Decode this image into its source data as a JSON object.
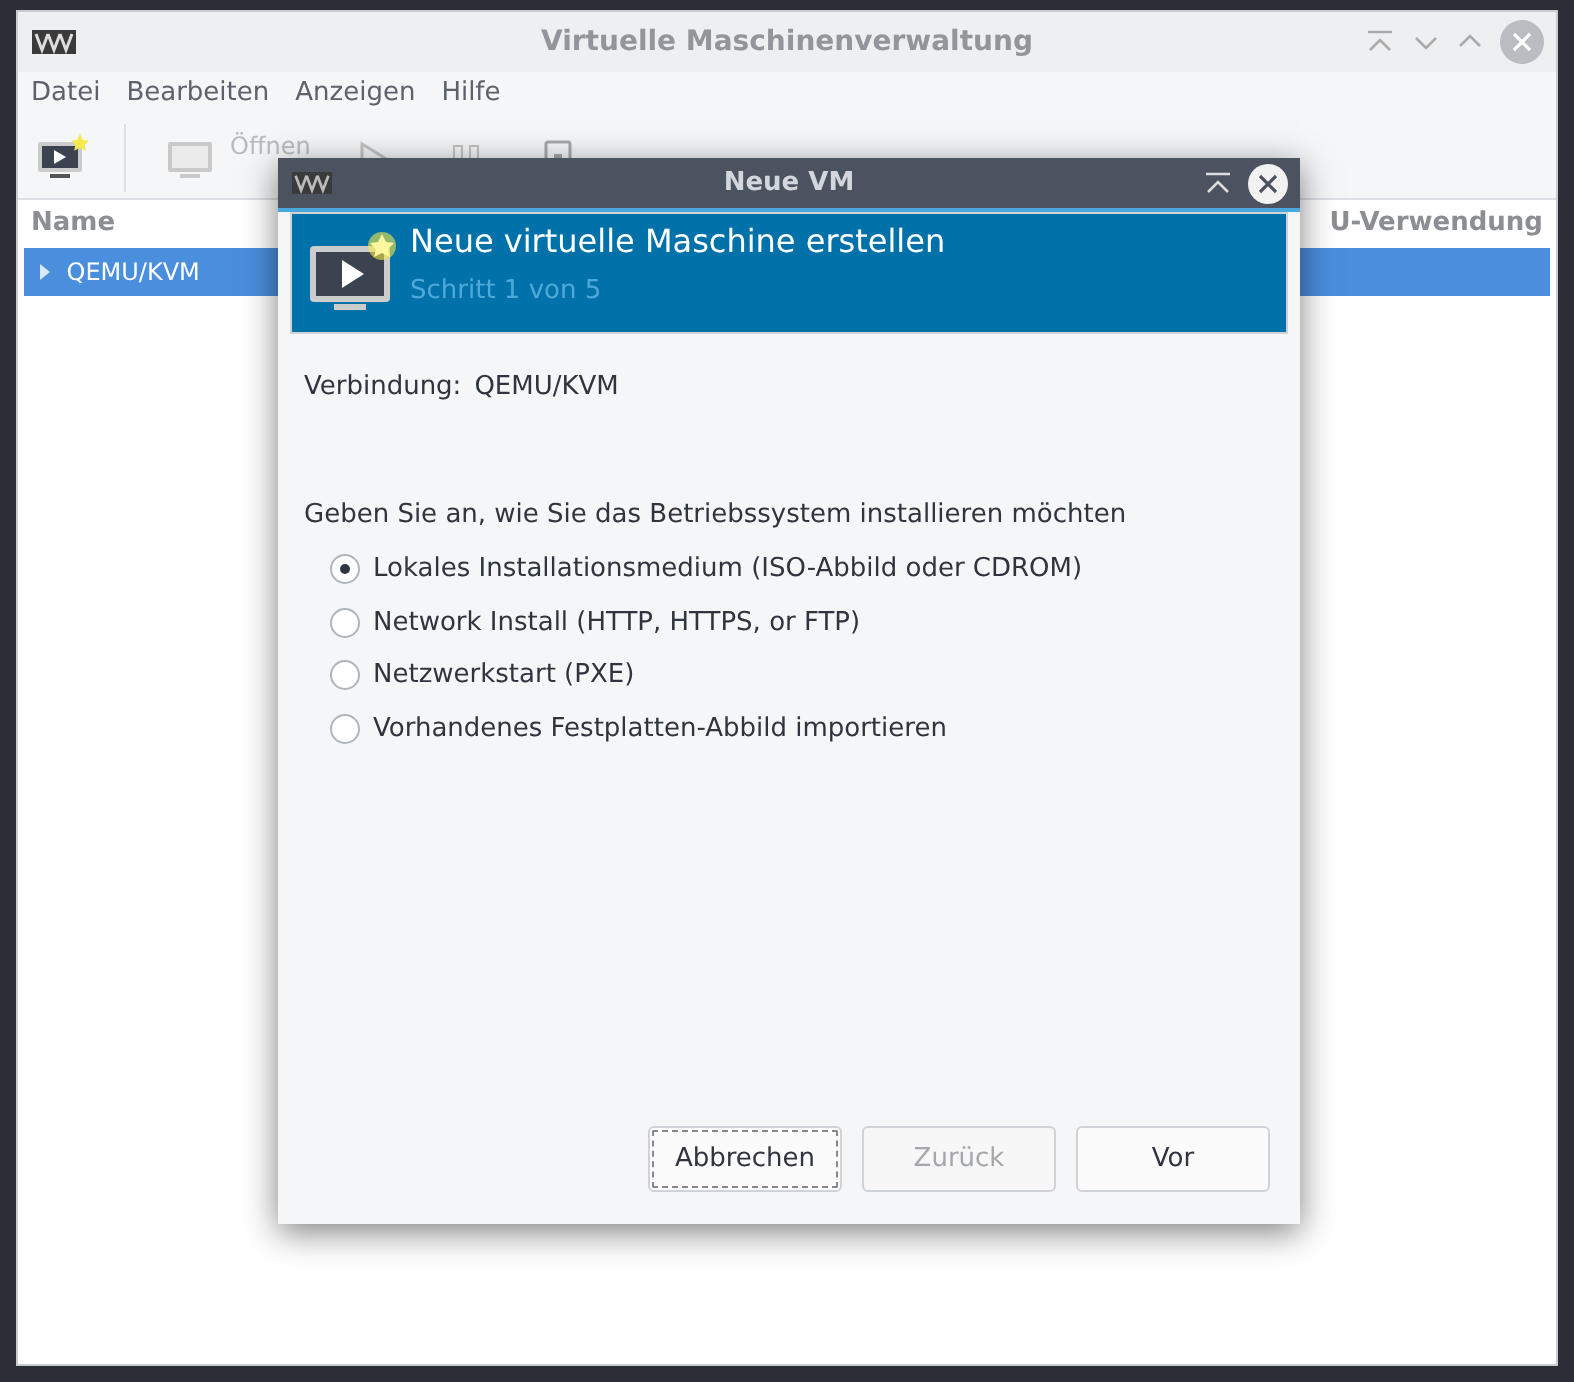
{
  "main_window": {
    "title": "Virtuelle Maschinenverwaltung",
    "menu": [
      "Datei",
      "Bearbeiten",
      "Anzeigen",
      "Hilfe"
    ],
    "toolbar": [
      {
        "kind": "new",
        "disabled": false
      },
      {
        "kind": "open",
        "label": "Öffnen",
        "disabled": true
      },
      {
        "kind": "play",
        "disabled": true
      },
      {
        "kind": "pause",
        "disabled": true
      },
      {
        "kind": "stop",
        "disabled": true
      }
    ],
    "columns": [
      "Name",
      "U-Verwendung"
    ],
    "rows": [
      {
        "label": "QEMU/KVM",
        "selected": true,
        "expanded": false
      }
    ]
  },
  "dialog": {
    "title": "Neue VM",
    "header_title": "Neue virtuelle Maschine erstellen",
    "header_step": "Schritt 1 von 5",
    "connection_label": "Verbindung:",
    "connection_value": "QEMU/KVM",
    "prompt": "Geben Sie an, wie Sie das Betriebssystem installieren möchten",
    "options": [
      {
        "label": "Lokales Installationsmedium (ISO-Abbild oder CDROM)",
        "selected": true
      },
      {
        "label": "Network Install (HTTP, HTTPS, or FTP)",
        "selected": false
      },
      {
        "label": "Netzwerkstart (PXE)",
        "selected": false
      },
      {
        "label": "Vorhandenes Festplatten-Abbild importieren",
        "selected": false
      }
    ],
    "buttons": [
      {
        "label": "Abbrechen",
        "disabled": false,
        "focused": true
      },
      {
        "label": "Zurück",
        "disabled": true,
        "focused": false
      },
      {
        "label": "Vor",
        "disabled": false,
        "focused": false
      }
    ]
  }
}
